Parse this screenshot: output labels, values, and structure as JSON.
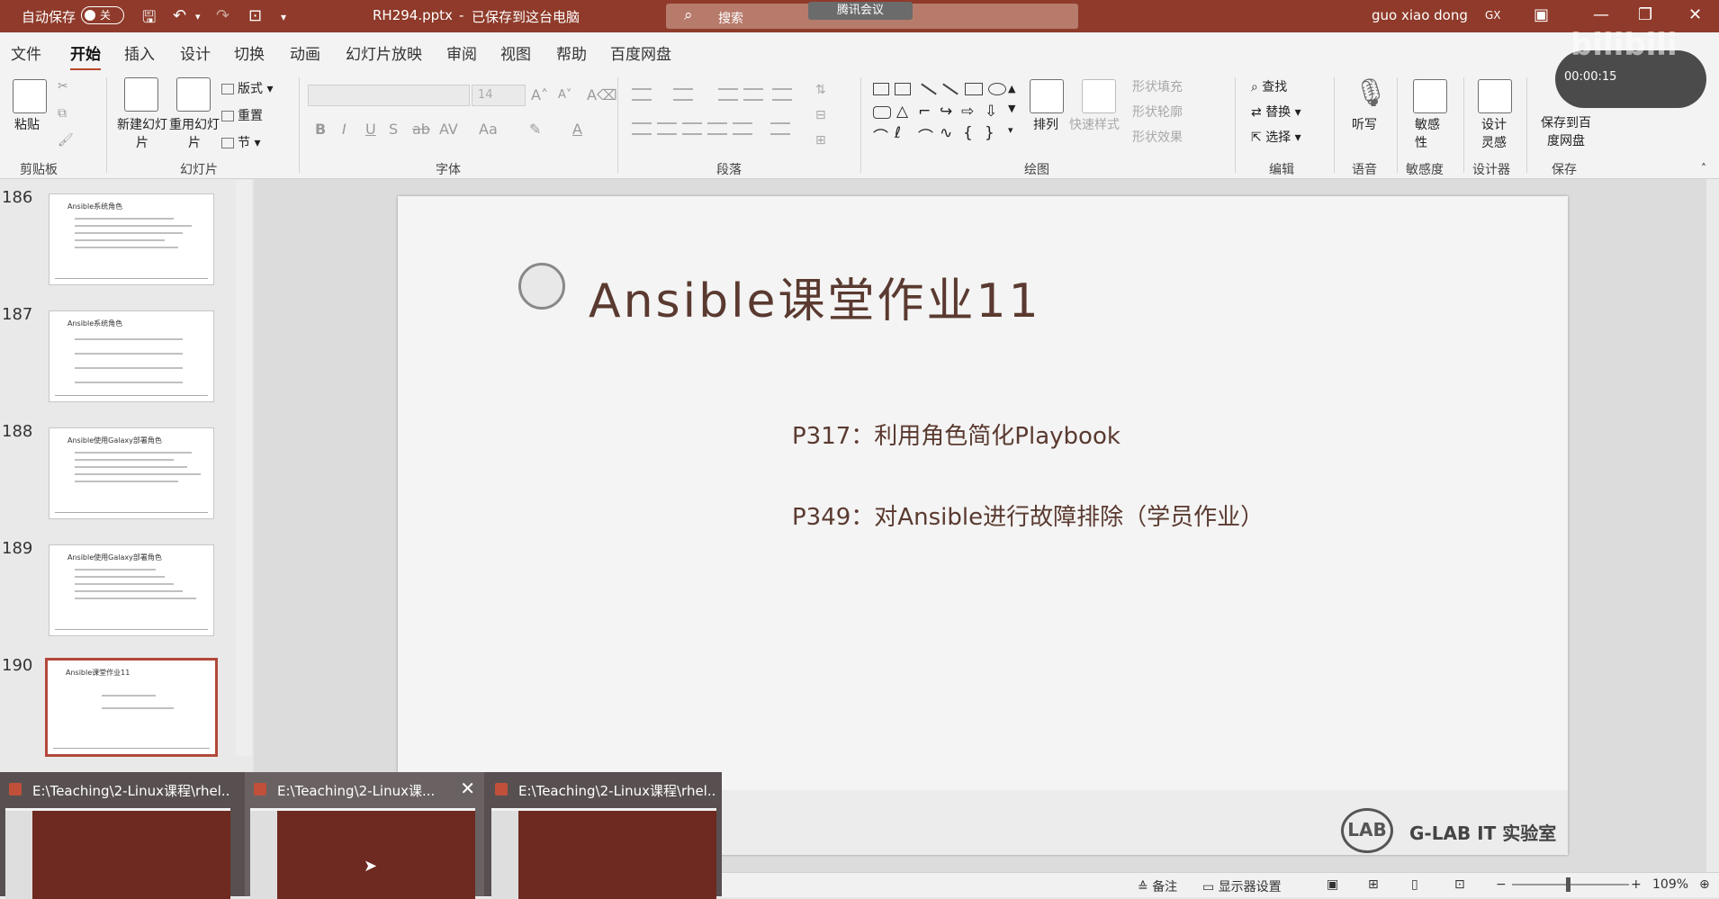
{
  "titlebar": {
    "autosave_label": "自动保存",
    "autosave_state": "关",
    "doc_title": "RH294.pptx",
    "save_status": "已保存到这台电脑",
    "search_placeholder": "搜索",
    "meeting_badge": "腾讯会议",
    "user_name": "guo xiao dong",
    "user_initials": "GX"
  },
  "tabs": [
    "文件",
    "开始",
    "插入",
    "设计",
    "切换",
    "动画",
    "幻灯片放映",
    "审阅",
    "视图",
    "帮助",
    "百度网盘"
  ],
  "active_tab": "开始",
  "ribbon": {
    "clipboard": {
      "paste": "粘贴",
      "group": "剪贴板"
    },
    "slides": {
      "new_slide": "新建幻灯片",
      "reuse_slide": "重用幻灯片",
      "layout": "版式",
      "reset": "重置",
      "section": "节",
      "group": "幻灯片"
    },
    "font": {
      "size": "14",
      "group": "字体"
    },
    "paragraph": {
      "group": "段落"
    },
    "drawing": {
      "arrange": "排列",
      "quick_styles": "快速样式",
      "shape_fill": "形状填充",
      "shape_outline": "形状轮廓",
      "shape_effects": "形状效果",
      "group": "绘图"
    },
    "editing": {
      "find": "查找",
      "replace": "替换",
      "select": "选择",
      "group": "编辑"
    },
    "voice": {
      "dictate": "听写",
      "group": "语音"
    },
    "sensitivity": {
      "label": "敏感性",
      "group": "敏感度"
    },
    "designer": {
      "label": "设计灵感",
      "group": "设计器"
    },
    "save": {
      "label": "保存到百度网盘",
      "group": "保存"
    }
  },
  "thumbnails": [
    {
      "num": "186",
      "title": "Ansible系统角色"
    },
    {
      "num": "187",
      "title": "Ansible系统角色"
    },
    {
      "num": "188",
      "title": "Ansible使用Galaxy部署角色"
    },
    {
      "num": "189",
      "title": "Ansible使用Galaxy部署角色"
    },
    {
      "num": "190",
      "title": "Ansible课堂作业11"
    }
  ],
  "selected_slide": "190",
  "slide": {
    "title": "Ansible课堂作业11",
    "line1": "P317：利用角色简化Playbook",
    "line2": "P349：对Ansible进行故障排除（学员作业）",
    "logo_text": "LAB",
    "lab_name": "G-LAB IT 实验室"
  },
  "statusbar": {
    "notes": "备注",
    "display_settings": "显示器设置",
    "zoom": "109%"
  },
  "taskbar_previews": [
    {
      "title": "E:\\Teaching\\2-Linux课程\\rhel..."
    },
    {
      "title": "E:\\Teaching\\2-Linux课..."
    },
    {
      "title": "E:\\Teaching\\2-Linux课程\\rhel..."
    }
  ],
  "recording_overlay": {
    "time": "00:00:15"
  },
  "watermark": "bilibili",
  "colors": {
    "brand": "#8f3a2a",
    "accent": "#b7472a",
    "slide_text": "#5a3a30"
  }
}
